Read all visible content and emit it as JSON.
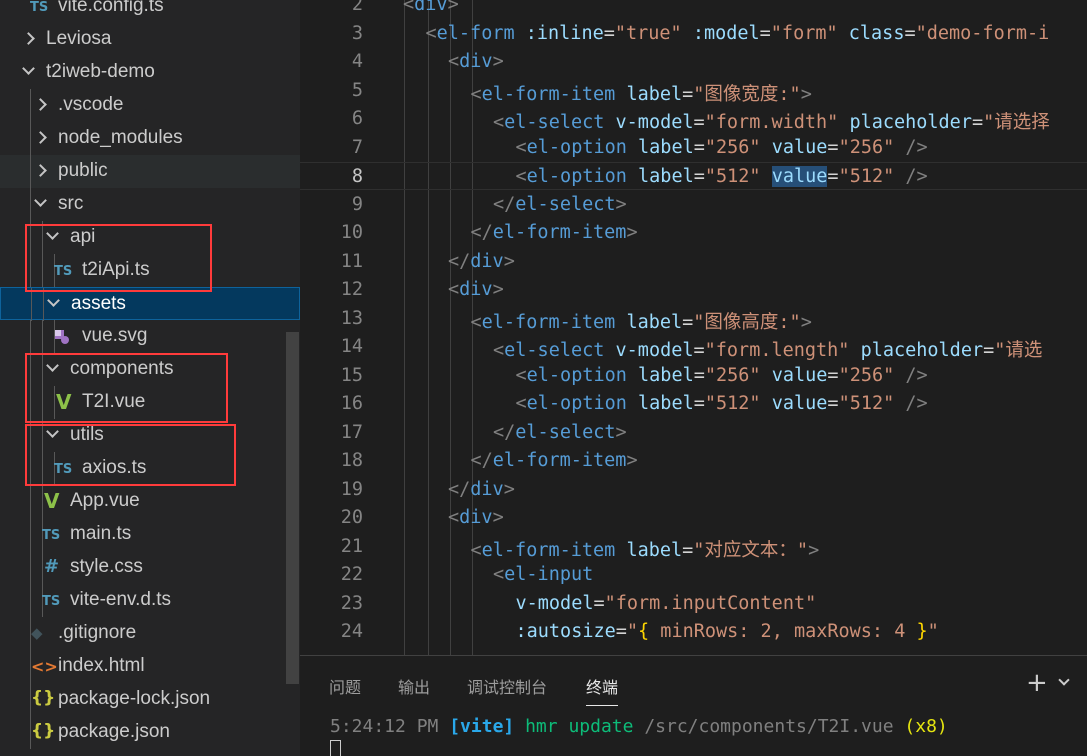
{
  "explorer": {
    "items": [
      {
        "label": "vite.config.ts",
        "type": "file",
        "icon": "TS"
      },
      {
        "label": "Leviosa",
        "type": "folder",
        "expanded": false
      },
      {
        "label": "t2iweb-demo",
        "type": "folder",
        "expanded": true
      },
      {
        "label": ".vscode",
        "type": "folder",
        "expanded": false
      },
      {
        "label": "node_modules",
        "type": "folder",
        "expanded": false
      },
      {
        "label": "public",
        "type": "folder",
        "expanded": false
      },
      {
        "label": "src",
        "type": "folder",
        "expanded": true
      },
      {
        "label": "api",
        "type": "folder",
        "expanded": true
      },
      {
        "label": "t2iApi.ts",
        "type": "file",
        "icon": "TS"
      },
      {
        "label": "assets",
        "type": "folder",
        "expanded": true,
        "selected": true
      },
      {
        "label": "vue.svg",
        "type": "file",
        "icon": "svg"
      },
      {
        "label": "components",
        "type": "folder",
        "expanded": true
      },
      {
        "label": "T2I.vue",
        "type": "file",
        "icon": "vue"
      },
      {
        "label": "utils",
        "type": "folder",
        "expanded": true
      },
      {
        "label": "axios.ts",
        "type": "file",
        "icon": "TS"
      },
      {
        "label": "App.vue",
        "type": "file",
        "icon": "vue"
      },
      {
        "label": "main.ts",
        "type": "file",
        "icon": "TS"
      },
      {
        "label": "style.css",
        "type": "file",
        "icon": "#"
      },
      {
        "label": "vite-env.d.ts",
        "type": "file",
        "icon": "TS"
      },
      {
        "label": ".gitignore",
        "type": "file",
        "icon": "git"
      },
      {
        "label": "index.html",
        "type": "file",
        "icon": "<>"
      },
      {
        "label": "package-lock.json",
        "type": "file",
        "icon": "{}"
      },
      {
        "label": "package.json",
        "type": "file",
        "icon": "{}"
      }
    ]
  },
  "editor": {
    "active_line": "8",
    "lines": [
      {
        "n": "2",
        "parts": [
          [
            "t",
            "<"
          ],
          [
            "tg",
            "div"
          ],
          [
            "t",
            ">"
          ]
        ]
      },
      {
        "n": "3",
        "parts": [
          [
            "t",
            "<"
          ],
          [
            "tg",
            "el-form"
          ],
          [
            "pl",
            " "
          ],
          [
            "at",
            ":inline"
          ],
          [
            "pl",
            "="
          ],
          [
            "st",
            "\"true\""
          ],
          [
            "pl",
            " "
          ],
          [
            "at",
            ":model"
          ],
          [
            "pl",
            "="
          ],
          [
            "st",
            "\"form\""
          ],
          [
            "pl",
            " "
          ],
          [
            "at",
            "class"
          ],
          [
            "pl",
            "="
          ],
          [
            "st",
            "\"demo-form-i"
          ]
        ]
      },
      {
        "n": "4",
        "parts": [
          [
            "t",
            "<"
          ],
          [
            "tg",
            "div"
          ],
          [
            "t",
            ">"
          ]
        ]
      },
      {
        "n": "5",
        "parts": [
          [
            "t",
            "<"
          ],
          [
            "tg",
            "el-form-item"
          ],
          [
            "pl",
            " "
          ],
          [
            "at",
            "label"
          ],
          [
            "pl",
            "="
          ],
          [
            "st",
            "\"图像宽度:\""
          ],
          [
            "t",
            ">"
          ]
        ]
      },
      {
        "n": "6",
        "parts": [
          [
            "t",
            "<"
          ],
          [
            "tg",
            "el-select"
          ],
          [
            "pl",
            " "
          ],
          [
            "at",
            "v-model"
          ],
          [
            "pl",
            "="
          ],
          [
            "st",
            "\"form.width\""
          ],
          [
            "pl",
            " "
          ],
          [
            "at",
            "placeholder"
          ],
          [
            "pl",
            "="
          ],
          [
            "st",
            "\"请选择"
          ]
        ]
      },
      {
        "n": "7",
        "parts": [
          [
            "t",
            "<"
          ],
          [
            "tg",
            "el-option"
          ],
          [
            "pl",
            " "
          ],
          [
            "at",
            "label"
          ],
          [
            "pl",
            "="
          ],
          [
            "st",
            "\"256\""
          ],
          [
            "pl",
            " "
          ],
          [
            "at",
            "value"
          ],
          [
            "pl",
            "="
          ],
          [
            "st",
            "\"256\""
          ],
          [
            "pl",
            " "
          ],
          [
            "t",
            "/>"
          ]
        ]
      },
      {
        "n": "8",
        "parts": [
          [
            "t",
            "<"
          ],
          [
            "tg",
            "el-option"
          ],
          [
            "pl",
            " "
          ],
          [
            "at",
            "label"
          ],
          [
            "pl",
            "="
          ],
          [
            "st",
            "\"512\""
          ],
          [
            "pl",
            " "
          ],
          [
            "at hl",
            "value"
          ],
          [
            "pl",
            "="
          ],
          [
            "st",
            "\"512\""
          ],
          [
            "pl",
            " "
          ],
          [
            "t",
            "/>"
          ]
        ]
      },
      {
        "n": "9",
        "parts": [
          [
            "t",
            "</"
          ],
          [
            "tg",
            "el-select"
          ],
          [
            "t",
            ">"
          ]
        ]
      },
      {
        "n": "10",
        "parts": [
          [
            "t",
            "</"
          ],
          [
            "tg",
            "el-form-item"
          ],
          [
            "t",
            ">"
          ]
        ]
      },
      {
        "n": "11",
        "parts": [
          [
            "t",
            "</"
          ],
          [
            "tg",
            "div"
          ],
          [
            "t",
            ">"
          ]
        ]
      },
      {
        "n": "12",
        "parts": [
          [
            "t",
            "<"
          ],
          [
            "tg",
            "div"
          ],
          [
            "t",
            ">"
          ]
        ]
      },
      {
        "n": "13",
        "parts": [
          [
            "t",
            "<"
          ],
          [
            "tg",
            "el-form-item"
          ],
          [
            "pl",
            " "
          ],
          [
            "at",
            "label"
          ],
          [
            "pl",
            "="
          ],
          [
            "st",
            "\"图像高度:\""
          ],
          [
            "t",
            ">"
          ]
        ]
      },
      {
        "n": "14",
        "parts": [
          [
            "t",
            "<"
          ],
          [
            "tg",
            "el-select"
          ],
          [
            "pl",
            " "
          ],
          [
            "at",
            "v-model"
          ],
          [
            "pl",
            "="
          ],
          [
            "st",
            "\"form.length\""
          ],
          [
            "pl",
            " "
          ],
          [
            "at",
            "placeholder"
          ],
          [
            "pl",
            "="
          ],
          [
            "st",
            "\"请选"
          ]
        ]
      },
      {
        "n": "15",
        "parts": [
          [
            "t",
            "<"
          ],
          [
            "tg",
            "el-option"
          ],
          [
            "pl",
            " "
          ],
          [
            "at",
            "label"
          ],
          [
            "pl",
            "="
          ],
          [
            "st",
            "\"256\""
          ],
          [
            "pl",
            " "
          ],
          [
            "at",
            "value"
          ],
          [
            "pl",
            "="
          ],
          [
            "st",
            "\"256\""
          ],
          [
            "pl",
            " "
          ],
          [
            "t",
            "/>"
          ]
        ]
      },
      {
        "n": "16",
        "parts": [
          [
            "t",
            "<"
          ],
          [
            "tg",
            "el-option"
          ],
          [
            "pl",
            " "
          ],
          [
            "at",
            "label"
          ],
          [
            "pl",
            "="
          ],
          [
            "st",
            "\"512\""
          ],
          [
            "pl",
            " "
          ],
          [
            "at",
            "value"
          ],
          [
            "pl",
            "="
          ],
          [
            "st",
            "\"512\""
          ],
          [
            "pl",
            " "
          ],
          [
            "t",
            "/>"
          ]
        ]
      },
      {
        "n": "17",
        "parts": [
          [
            "t",
            "</"
          ],
          [
            "tg",
            "el-select"
          ],
          [
            "t",
            ">"
          ]
        ]
      },
      {
        "n": "18",
        "parts": [
          [
            "t",
            "</"
          ],
          [
            "tg",
            "el-form-item"
          ],
          [
            "t",
            ">"
          ]
        ]
      },
      {
        "n": "19",
        "parts": [
          [
            "t",
            "</"
          ],
          [
            "tg",
            "div"
          ],
          [
            "t",
            ">"
          ]
        ]
      },
      {
        "n": "20",
        "parts": [
          [
            "t",
            "<"
          ],
          [
            "tg",
            "div"
          ],
          [
            "t",
            ">"
          ]
        ]
      },
      {
        "n": "21",
        "parts": [
          [
            "t",
            "<"
          ],
          [
            "tg",
            "el-form-item"
          ],
          [
            "pl",
            " "
          ],
          [
            "at",
            "label"
          ],
          [
            "pl",
            "="
          ],
          [
            "st",
            "\"对应文本：\""
          ],
          [
            "t",
            ">"
          ]
        ]
      },
      {
        "n": "22",
        "parts": [
          [
            "t",
            "<"
          ],
          [
            "tg",
            "el-input"
          ]
        ]
      },
      {
        "n": "23",
        "parts": [
          [
            "at",
            "v-model"
          ],
          [
            "pl",
            "="
          ],
          [
            "st",
            "\"form.inputContent\""
          ]
        ]
      },
      {
        "n": "24",
        "parts": [
          [
            "at",
            ":autosize"
          ],
          [
            "pl",
            "="
          ],
          [
            "st",
            "\""
          ],
          [
            "br",
            "{"
          ],
          [
            "st",
            " minRows: 2, maxRows: 4 "
          ],
          [
            "br",
            "}"
          ],
          [
            "st",
            "\""
          ]
        ]
      }
    ]
  },
  "panel": {
    "tabs": [
      "问题",
      "输出",
      "调试控制台",
      "终端"
    ],
    "active_tab": "终端",
    "terminal": {
      "time": "5:24:12 PM",
      "tag": "[vite]",
      "action": "hmr update",
      "path": "/src/components/T2I.vue",
      "count": "(x8)"
    },
    "new_terminal_icon": "plus-icon"
  }
}
